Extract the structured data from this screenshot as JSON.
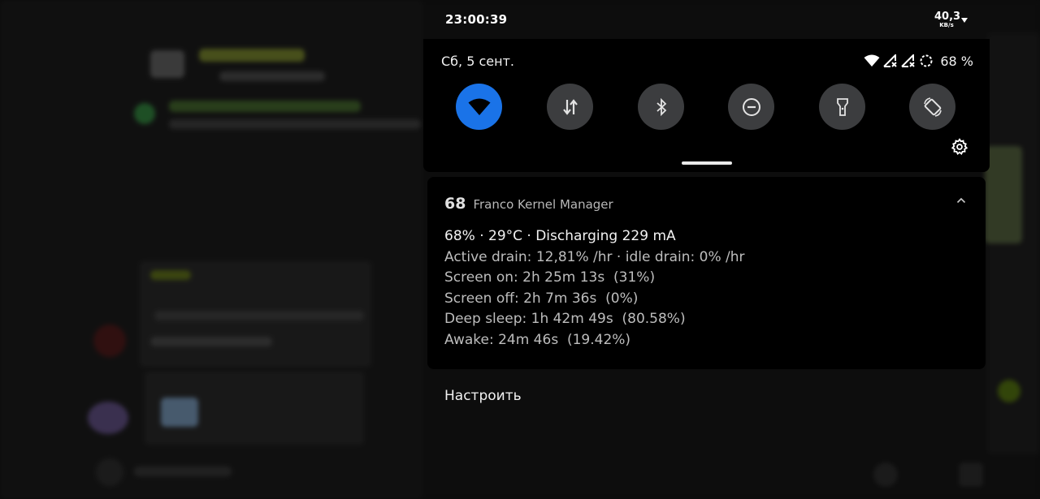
{
  "statusbar": {
    "clock": "23:00:39",
    "net_speed_value": "40,3",
    "net_speed_unit": "KB/s",
    "signal_arrow_icon": "triangle-down-icon"
  },
  "quick_settings": {
    "date": "Сб, 5 сент.",
    "battery_percent": "68 %",
    "status_icons": [
      "wifi-icon",
      "no-signal-sim1-icon",
      "no-signal-sim2-icon",
      "battery-saver-ring-icon"
    ],
    "tiles": [
      {
        "name": "wifi",
        "icon": "wifi-icon",
        "active": true
      },
      {
        "name": "mobile-data",
        "icon": "data-arrows-icon",
        "active": false
      },
      {
        "name": "bluetooth",
        "icon": "bluetooth-icon",
        "active": false
      },
      {
        "name": "do-not-disturb",
        "icon": "dnd-icon",
        "active": false
      },
      {
        "name": "flashlight",
        "icon": "flashlight-icon",
        "active": false
      },
      {
        "name": "auto-rotate",
        "icon": "rotate-icon",
        "active": false
      }
    ],
    "settings_icon": "gear-icon",
    "accent_color": "#1a73e8"
  },
  "notification": {
    "icon_text": "68",
    "app_name": "Franco Kernel Manager",
    "expand_icon": "chevron-up-icon",
    "lines": [
      "68% · 29°C · Discharging 229 mA",
      "Active drain: 12,81% /hr · idle drain: 0% /hr",
      "Screen on: 2h 25m 13s  (31%)",
      "Screen off: 2h 7m 36s  (0%)",
      "Deep sleep: 1h 42m 49s  (80.58%)",
      "Awake: 24m 46s  (19.42%)"
    ]
  },
  "customize_label": "Настроить"
}
